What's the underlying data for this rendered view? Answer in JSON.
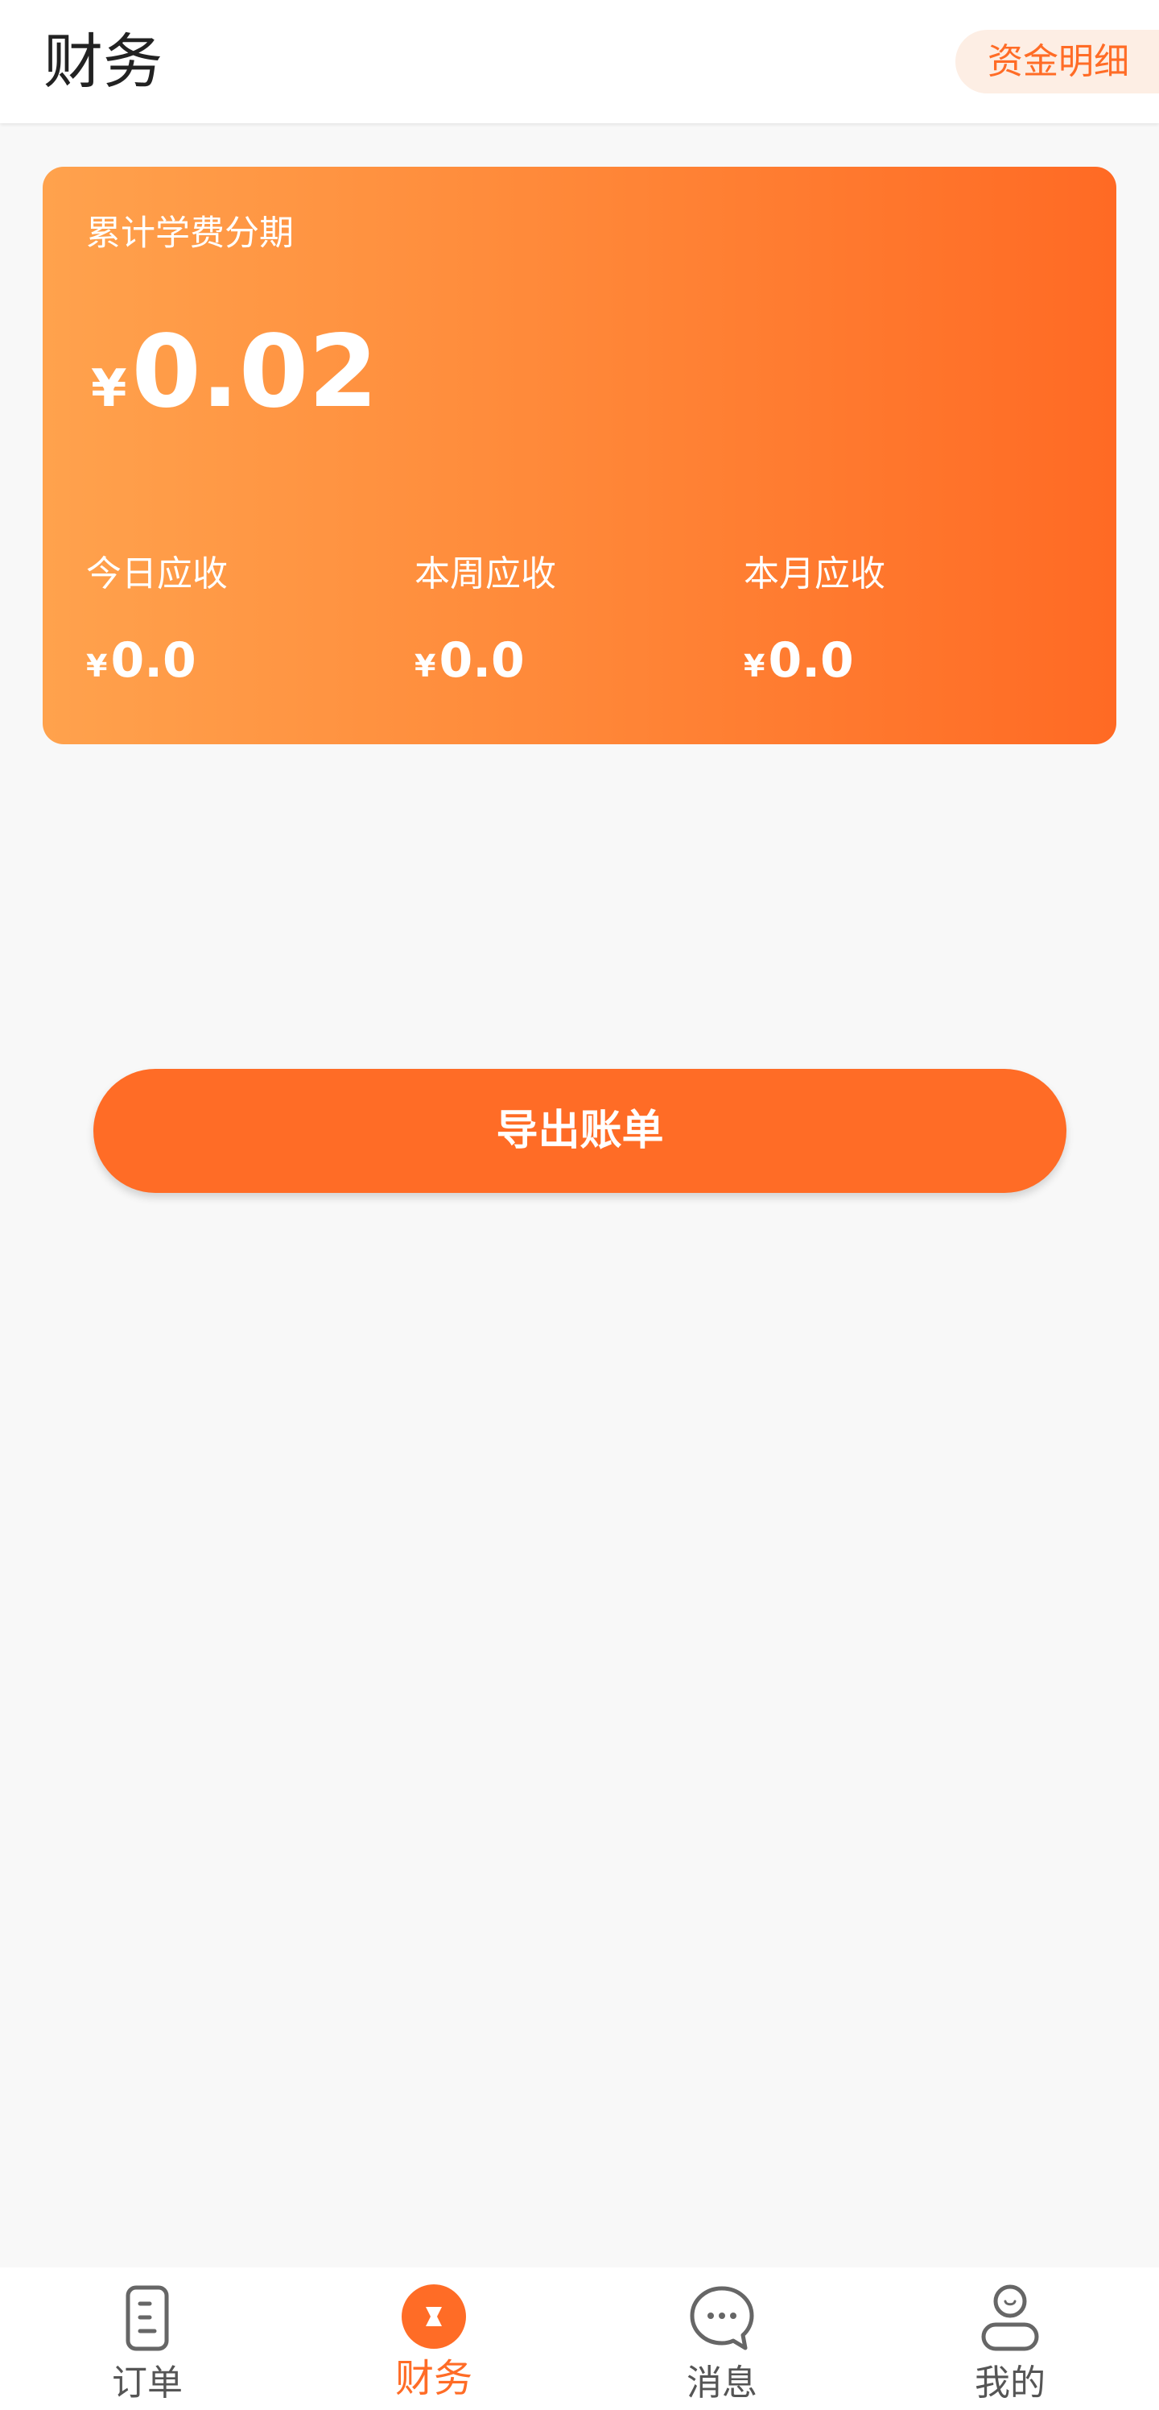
{
  "header": {
    "title": "财务",
    "action_label": "资金明细"
  },
  "summary_card": {
    "label": "累计学费分期",
    "currency": "¥",
    "total": "0.02",
    "stats": [
      {
        "label": "今日应收",
        "currency": "¥",
        "value": "0.0"
      },
      {
        "label": "本周应收",
        "currency": "¥",
        "value": "0.0"
      },
      {
        "label": "本月应收",
        "currency": "¥",
        "value": "0.0"
      }
    ]
  },
  "export_button": {
    "label": "导出账单"
  },
  "tabbar": {
    "items": [
      {
        "label": "订单",
        "icon": "order-icon",
        "active": false
      },
      {
        "label": "财务",
        "icon": "finance-icon",
        "active": true
      },
      {
        "label": "消息",
        "icon": "message-icon",
        "active": false
      },
      {
        "label": "我的",
        "icon": "profile-icon",
        "active": false
      }
    ]
  },
  "colors": {
    "accent": "#ff6c26",
    "card_gradient_start": "#ffa24d",
    "card_gradient_end": "#ff6a24",
    "background": "#f8f8f8"
  }
}
